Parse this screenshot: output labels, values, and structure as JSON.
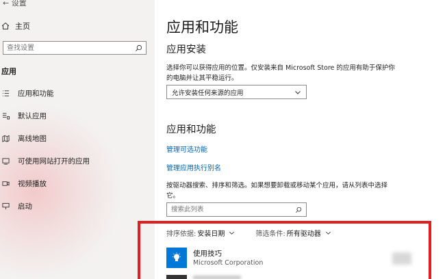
{
  "window": {
    "title": "← 设置"
  },
  "sidebar": {
    "home_label": "主页",
    "search_placeholder": "查找设置",
    "section": "应用",
    "items": [
      {
        "label": "应用和功能",
        "icon": "list-icon"
      },
      {
        "label": "默认应用",
        "icon": "default-apps-icon"
      },
      {
        "label": "离线地图",
        "icon": "map-icon"
      },
      {
        "label": "可使用网站打开的应用",
        "icon": "web-open-icon"
      },
      {
        "label": "视频播放",
        "icon": "video-icon"
      },
      {
        "label": "启动",
        "icon": "startup-icon"
      }
    ]
  },
  "main": {
    "title": "应用和功能",
    "install": {
      "heading": "应用安装",
      "description": "选择你可以获得应用的位置。仅安装来自 Microsoft Store 的应用有助于保护你的电脑并让其平稳运行。",
      "dropdown_value": "允许安装任何来源的应用"
    },
    "apps": {
      "heading": "应用和功能",
      "link_optional": "管理可选功能",
      "link_alias": "管理应用执行别名",
      "description": "按驱动器搜索、排序和筛选。如果想要卸载或移动某个应用，请从列表中选择它。",
      "search_placeholder": "搜索此列表",
      "sort_label": "排序依据:",
      "sort_value": "安装日期",
      "filter_label": "筛选条件:",
      "filter_value": "所有驱动器",
      "list": [
        {
          "name": "使用技巧",
          "publisher": "Microsoft Corporation",
          "icon": "lightbulb-icon"
        }
      ]
    }
  },
  "colors": {
    "accent": "#0078d7",
    "link": "#0063b1",
    "highlight": "#e02020",
    "sidebar_bg": "#f3f2f1"
  }
}
